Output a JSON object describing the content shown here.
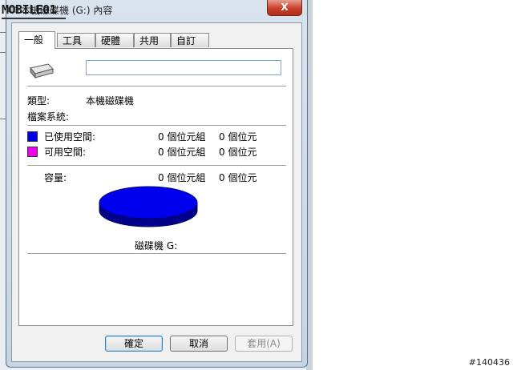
{
  "watermark": "MOBILE01",
  "corner_id": "#140436",
  "window": {
    "title": "本機磁碟機 (G:) 內容",
    "close_label": "X"
  },
  "tabs": [
    {
      "label": "一般",
      "active": true
    },
    {
      "label": "工具",
      "active": false
    },
    {
      "label": "硬體",
      "active": false
    },
    {
      "label": "共用",
      "active": false
    },
    {
      "label": "自訂",
      "active": false
    }
  ],
  "general": {
    "name_value": "",
    "type_label": "類型:",
    "type_value": "本機磁碟機",
    "fs_label": "檔案系統:",
    "fs_value": "",
    "used": {
      "label": "已使用空間:",
      "bytes": "0 個位元組",
      "size": "0 個位元",
      "color": "#0000ee"
    },
    "free": {
      "label": "可用空間:",
      "bytes": "0 個位元組",
      "size": "0 個位元",
      "color": "#ee00ee"
    },
    "capacity": {
      "label": "容量:",
      "bytes": "0 個位元組",
      "size": "0 個位元"
    },
    "drive_label": "磁碟機 G:"
  },
  "buttons": {
    "ok": "確定",
    "cancel": "取消",
    "apply": "套用(A)"
  },
  "disk_chart": {
    "used_fraction": 1.0,
    "free_fraction": 0.0,
    "used_color": "#0000ee",
    "free_color": "#ee00ee"
  }
}
